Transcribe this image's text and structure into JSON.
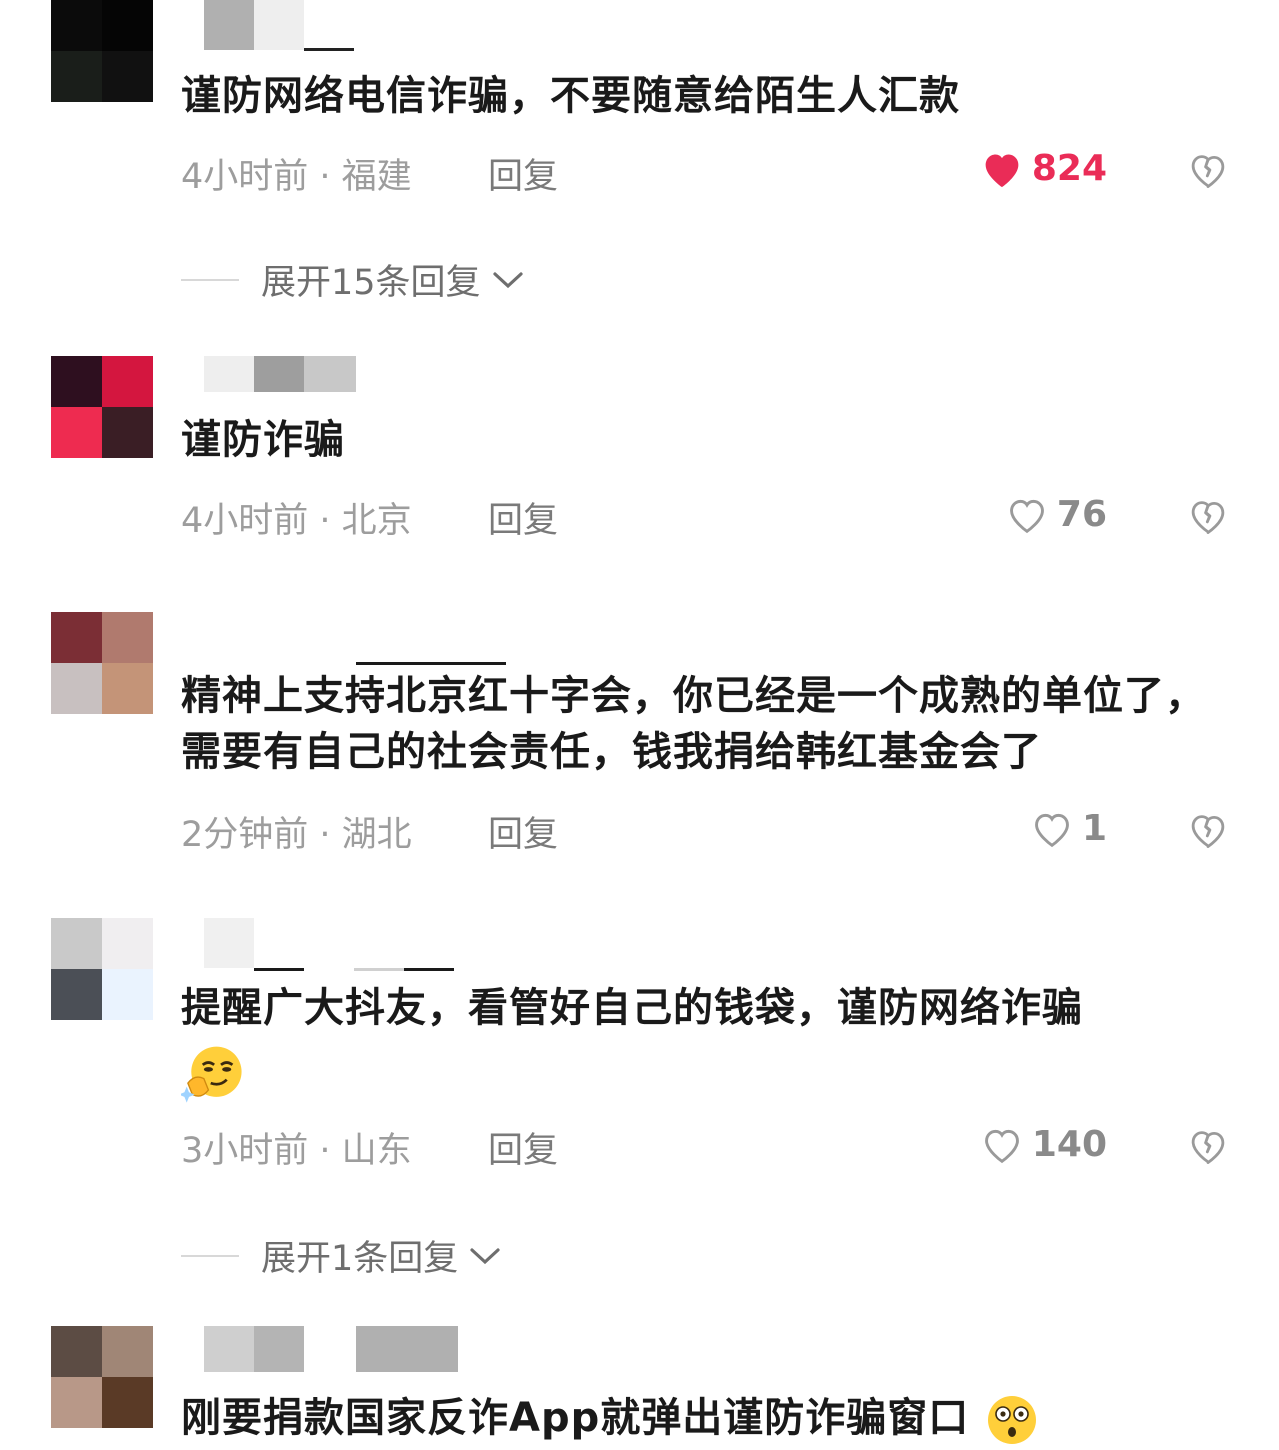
{
  "comments": [
    {
      "text": "谨防网络电信诈骗，不要随意给陌生人汇款",
      "meta": "4小时前 · 福建",
      "reply": "回复",
      "likes": "824",
      "liked": true,
      "expand": "展开15条回复",
      "avatar_colors": [
        "#0b0b0b",
        "#050505",
        "#1a1e1a",
        "#111111"
      ]
    },
    {
      "text": "谨防诈骗",
      "meta": "4小时前 · 北京",
      "reply": "回复",
      "likes": "76",
      "liked": false,
      "avatar_colors": [
        "#2e0f1f",
        "#d4163f",
        "#ee2b50",
        "#3a1e25"
      ]
    },
    {
      "text": "精神上支持北京红十字会，你已经是一个成熟的单位了，需要有自己的社会责任，钱我捐给韩红基金会了",
      "meta": "2分钟前 · 湖北",
      "reply": "回复",
      "likes": "1",
      "liked": false,
      "avatar_colors": [
        "#7b2e35",
        "#b07a6e",
        "#c8c0c0",
        "#c49478"
      ]
    },
    {
      "text": "提醒广大抖友，看管好自己的钱袋，谨防网络诈骗",
      "emoji": "thinking-smirk-emoji",
      "meta": "3小时前 · 山东",
      "reply": "回复",
      "likes": "140",
      "liked": false,
      "expand": "展开1条回复",
      "avatar_colors": [
        "#c9c9c9",
        "#f0eef0",
        "#4b4f56",
        "#eaf3fe"
      ]
    },
    {
      "text": "刚要捐款国家反诈App就弹出谨防诈骗窗口",
      "emoji": "shocked-emoji",
      "avatar_colors": [
        "#5c4c44",
        "#a08676",
        "#b89888",
        "#5a3a26"
      ]
    }
  ],
  "colors": {
    "text": "#1a1a1a",
    "meta": "#9d9d9d",
    "liked": "#ea2c57",
    "unliked": "#8a8a8a"
  }
}
